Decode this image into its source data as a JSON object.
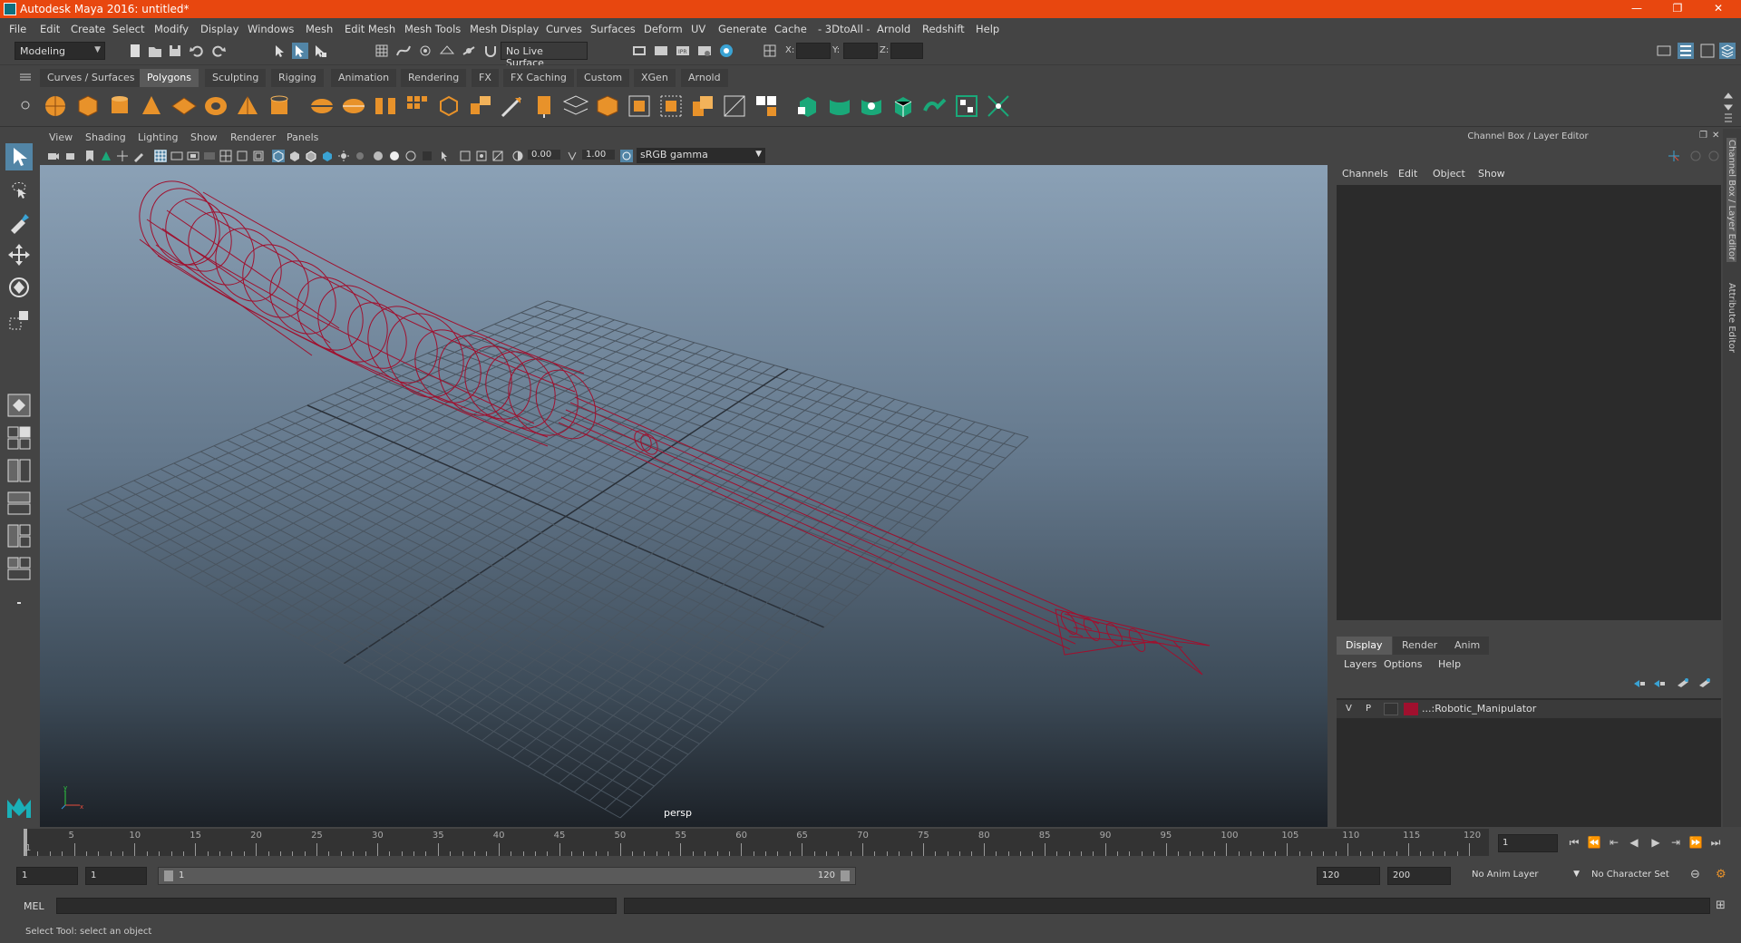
{
  "window": {
    "title": "Autodesk Maya 2016: untitled*",
    "minimize": "—",
    "restore": "❐",
    "close": "✕"
  },
  "menus": [
    "File",
    "Edit",
    "Create",
    "Select",
    "Modify",
    "Display",
    "Windows",
    "Mesh",
    "Edit Mesh",
    "Mesh Tools",
    "Mesh Display",
    "Curves",
    "Surfaces",
    "Deform",
    "UV",
    "Generate",
    "Cache",
    "- 3DtoAll -",
    "Arnold",
    "Redshift",
    "Help"
  ],
  "status_line": {
    "menuset": "Modeling",
    "live_surface": "No Live Surface",
    "x_label": "X:",
    "y_label": "Y:",
    "z_label": "Z:"
  },
  "shelf_tabs": [
    "Curves / Surfaces",
    "Polygons",
    "Sculpting",
    "Rigging",
    "Animation",
    "Rendering",
    "FX",
    "FX Caching",
    "Custom",
    "XGen",
    "Arnold"
  ],
  "active_shelf_tab": "Polygons",
  "viewport": {
    "menus": [
      "View",
      "Shading",
      "Lighting",
      "Show",
      "Renderer",
      "Panels"
    ],
    "exposure": "0.00",
    "gamma": "1.00",
    "color_space": "sRGB gamma",
    "camera_label": "persp"
  },
  "channel_box": {
    "title": "Channel Box / Layer Editor",
    "menus": [
      "Channels",
      "Edit",
      "Object",
      "Show"
    ]
  },
  "layer_editor": {
    "tabs": [
      "Display",
      "Render",
      "Anim"
    ],
    "active_tab": "Display",
    "menus": [
      "Layers",
      "Options",
      "Help"
    ],
    "layers": [
      {
        "visible": "V",
        "playback": "P",
        "name": "...:Robotic_Manipulator",
        "color": "#a0102e"
      }
    ]
  },
  "side_tabs": [
    "Channel Box / Layer Editor",
    "Attribute Editor"
  ],
  "timeline": {
    "ticks": [
      "5",
      "10",
      "15",
      "20",
      "25",
      "30",
      "35",
      "40",
      "45",
      "50",
      "55",
      "60",
      "65",
      "70",
      "75",
      "80",
      "85",
      "90",
      "95",
      "100",
      "105",
      "110",
      "115",
      "120"
    ],
    "first_label": "1",
    "current_frame": "1"
  },
  "range": {
    "start_time": "1",
    "playback_start": "1",
    "range_start_label": "1",
    "range_end_label": "120",
    "playback_end": "120",
    "end_time": "200",
    "anim_layer": "No Anim Layer",
    "character_set": "No Character Set"
  },
  "command_line": {
    "label": "MEL"
  },
  "help_line": "Select Tool: select an object",
  "colors": {
    "title_bar": "#e8470f",
    "wireframe": "#a0102e",
    "grid": "#4a5560"
  }
}
